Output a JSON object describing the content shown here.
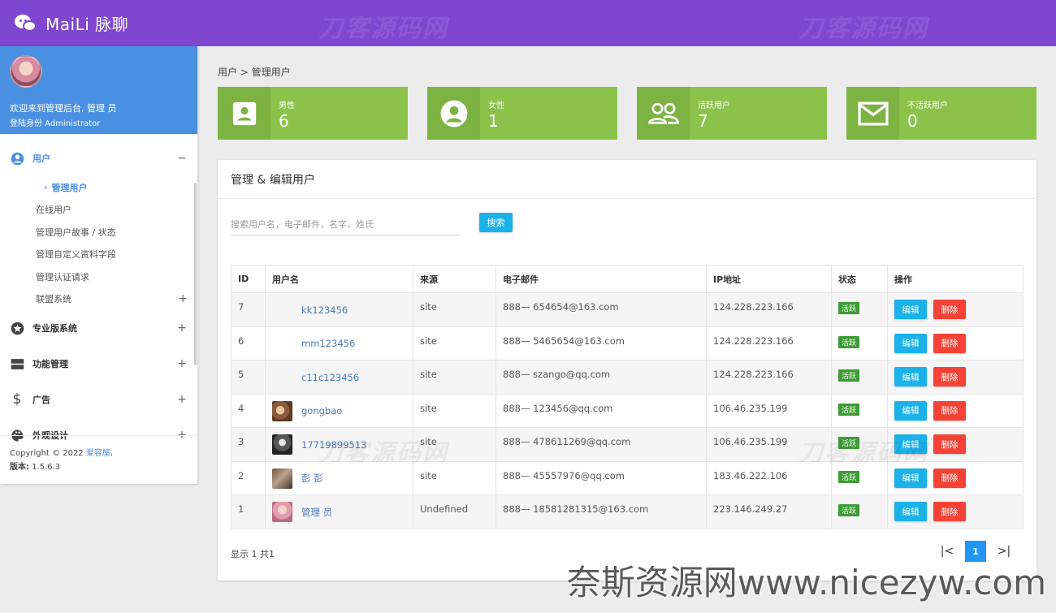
{
  "app": {
    "title": "MaiLi 脉聊"
  },
  "watermark": {
    "text": "刀客源码网",
    "bottom": "奈斯资源网www.nicezyw.com"
  },
  "sidebar": {
    "welcome": "欢迎来到管理后台, 管理 员",
    "role": "登陆身份 Administrator",
    "menu": [
      {
        "label": "用户",
        "toggle": "−",
        "icon": "user-circle-icon"
      },
      {
        "label": "专业版系统",
        "toggle": "+",
        "icon": "star-icon"
      },
      {
        "label": "功能管理",
        "toggle": "+",
        "icon": "server-icon"
      },
      {
        "label": "广告",
        "toggle": "+",
        "icon": "dollar-icon"
      },
      {
        "label": "外观设计",
        "toggle": "+",
        "icon": "palette-icon"
      }
    ],
    "submenu": [
      {
        "label": "管理用户"
      },
      {
        "label": "在线用户"
      },
      {
        "label": "管理用户故事 / 状态"
      },
      {
        "label": "管理自定义资料字段"
      },
      {
        "label": "管理认证请求"
      },
      {
        "label": "联盟系统",
        "toggle": "+"
      }
    ],
    "footer": {
      "copyright": "Copyright © 2022",
      "brand": "爱容屋",
      "version_label": "版本:",
      "version": "1.5.6.3"
    }
  },
  "breadcrumb": "用户 > 管理用户",
  "stats": [
    {
      "label": "男性",
      "value": "6",
      "icon": "male-card-icon"
    },
    {
      "label": "女性",
      "value": "1",
      "icon": "female-user-icon"
    },
    {
      "label": "活跃用户",
      "value": "7",
      "icon": "users-icon"
    },
    {
      "label": "不活跃用户",
      "value": "0",
      "icon": "mail-icon"
    }
  ],
  "card": {
    "title": "管理 & 编辑用户",
    "search_placeholder": "搜索用户名，电子邮件，名字，姓氏",
    "search_button": "搜索"
  },
  "table": {
    "columns": [
      "ID",
      "用户名",
      "来源",
      "电子邮件",
      "IP地址",
      "状态",
      "操作"
    ],
    "edit_label": "编辑",
    "delete_label": "删除",
    "rows": [
      {
        "id": "7",
        "username": "kk123456",
        "source": "site",
        "email": "888— 654654@163.com",
        "ip": "124.228.223.166",
        "status": "活跃",
        "avatar": "default"
      },
      {
        "id": "6",
        "username": "mm123456",
        "source": "site",
        "email": "888— 5465654@163.com",
        "ip": "124.228.223.166",
        "status": "活跃",
        "avatar": "default"
      },
      {
        "id": "5",
        "username": "c11c123456",
        "source": "site",
        "email": "888— szango@qq.com",
        "ip": "124.228.223.166",
        "status": "活跃",
        "avatar": "default"
      },
      {
        "id": "4",
        "username": "gongbao",
        "source": "site",
        "email": "888— 123456@qq.com",
        "ip": "106.46.235.199",
        "status": "活跃",
        "avatar": "food"
      },
      {
        "id": "3",
        "username": "17719899513",
        "source": "site",
        "email": "888— 478611269@qq.com",
        "ip": "106.46.235.199",
        "status": "活跃",
        "avatar": "dark"
      },
      {
        "id": "2",
        "username": "彭 彭",
        "source": "site",
        "email": "888— 45557976@qq.com",
        "ip": "183.46.222.106",
        "status": "活跃",
        "avatar": "photo"
      },
      {
        "id": "1",
        "username": "管理 员",
        "source": "Undefined",
        "email": "888— 18581281315@163.com",
        "ip": "223.146.249.27",
        "status": "活跃",
        "avatar": "pink"
      }
    ]
  },
  "footer": {
    "showing": "显示 1 共1",
    "page": "1",
    "first": "|<",
    "last": ">|"
  }
}
